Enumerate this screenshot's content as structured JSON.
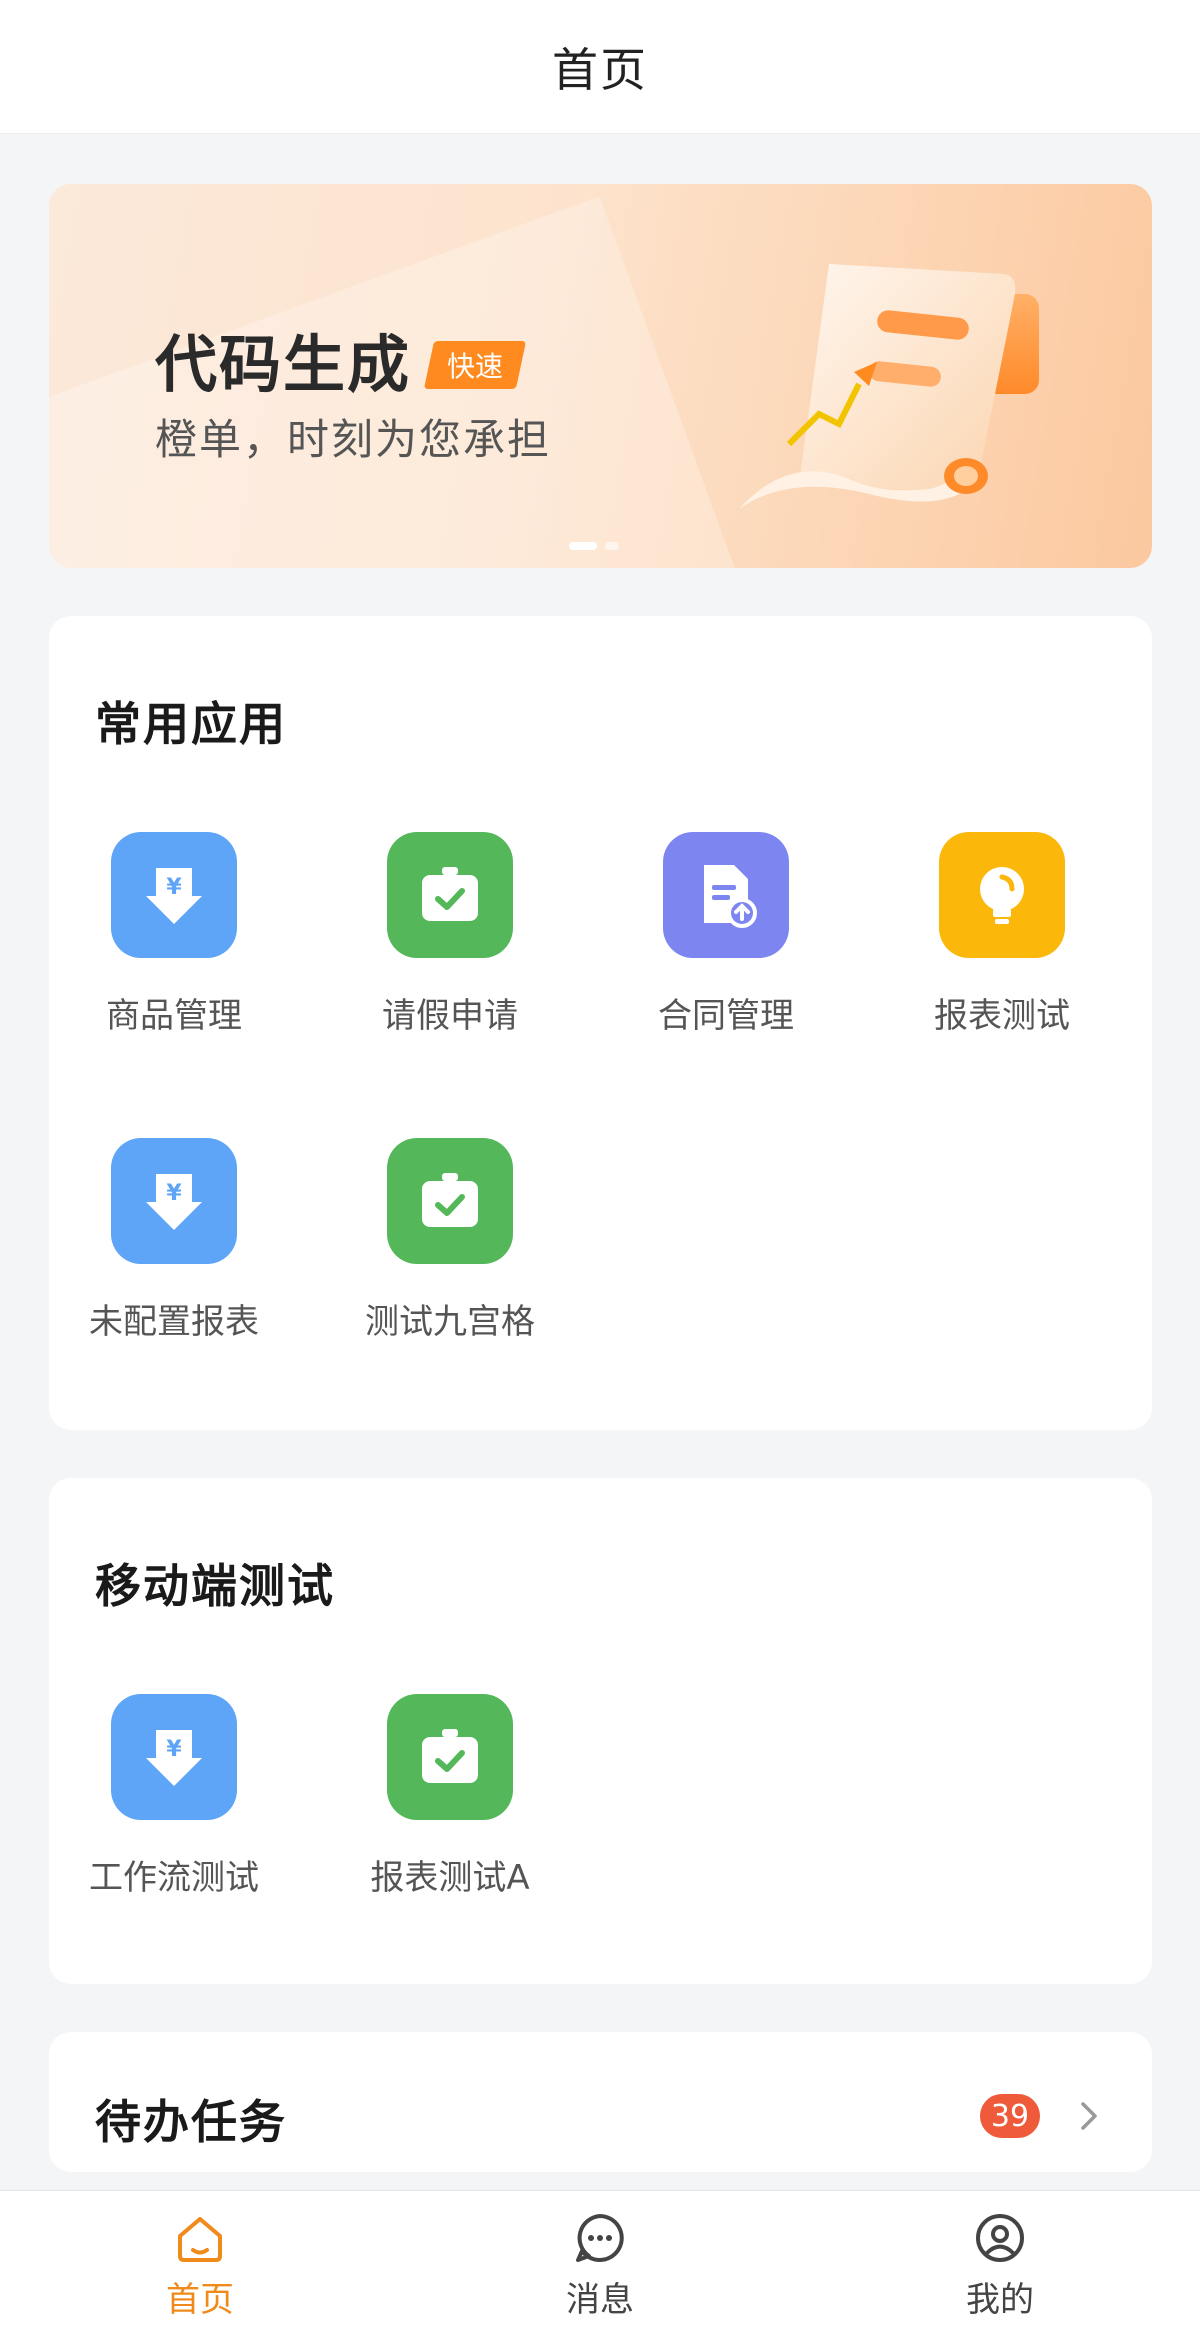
{
  "header": {
    "title": "首页"
  },
  "banner": {
    "headline": "代码生成",
    "tag": "快速",
    "subline": "橙单，时刻为您承担"
  },
  "common_apps": {
    "title": "常用应用",
    "items": [
      {
        "label": "商品管理",
        "icon": "yen-download-icon",
        "color": "#5ea5f8"
      },
      {
        "label": "请假申请",
        "icon": "briefcase-check-icon",
        "color": "#54b85a"
      },
      {
        "label": "合同管理",
        "icon": "document-upload-icon",
        "color": "#7d86f0"
      },
      {
        "label": "报表测试",
        "icon": "lightbulb-icon",
        "color": "#fbb80a"
      },
      {
        "label": "未配置报表",
        "icon": "yen-download-icon",
        "color": "#5ea5f8"
      },
      {
        "label": "测试九宫格",
        "icon": "briefcase-check-icon",
        "color": "#54b85a"
      }
    ]
  },
  "mobile_test": {
    "title": "移动端测试",
    "items": [
      {
        "label": "工作流测试",
        "icon": "yen-download-icon",
        "color": "#5ea5f8"
      },
      {
        "label": "报表测试A",
        "icon": "briefcase-check-icon",
        "color": "#54b85a"
      }
    ]
  },
  "todo": {
    "title": "待办任务",
    "count": "39"
  },
  "tabbar": {
    "items": [
      {
        "label": "首页",
        "icon": "home-icon",
        "active": true
      },
      {
        "label": "消息",
        "icon": "chat-bubble-icon",
        "active": false
      },
      {
        "label": "我的",
        "icon": "user-circle-icon",
        "active": false
      }
    ]
  },
  "colors": {
    "accent": "#f08a1a",
    "badge": "#ee5a3a"
  }
}
